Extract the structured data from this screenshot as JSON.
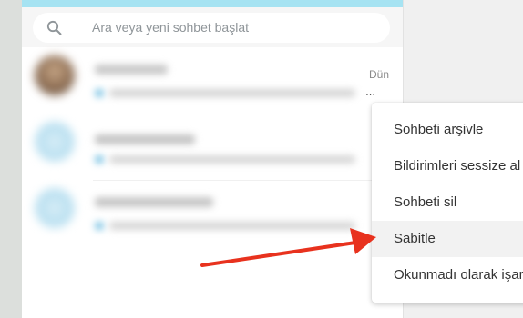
{
  "search": {
    "placeholder": "Ara veya yeni sohbet başlat",
    "icon": "search-icon"
  },
  "chat_list": {
    "rows": [
      {
        "time": "Dün",
        "preview": "..."
      },
      {
        "time": "",
        "preview": "..."
      },
      {
        "time": "",
        "preview": "..."
      }
    ]
  },
  "context_menu": {
    "items": [
      {
        "label": "Sohbeti arşivle"
      },
      {
        "label": "Bildirimleri sessize al"
      },
      {
        "label": "Sohbeti sil"
      },
      {
        "label": "Sabitle",
        "highlighted": true
      },
      {
        "label": "Okunmadı olarak işaretle"
      }
    ]
  },
  "annotation": {
    "arrow_color": "#e8321e",
    "target": "Sabitle"
  },
  "colors": {
    "accent_bar": "#a6e3f2",
    "menu_highlight": "#f2f2f2"
  }
}
